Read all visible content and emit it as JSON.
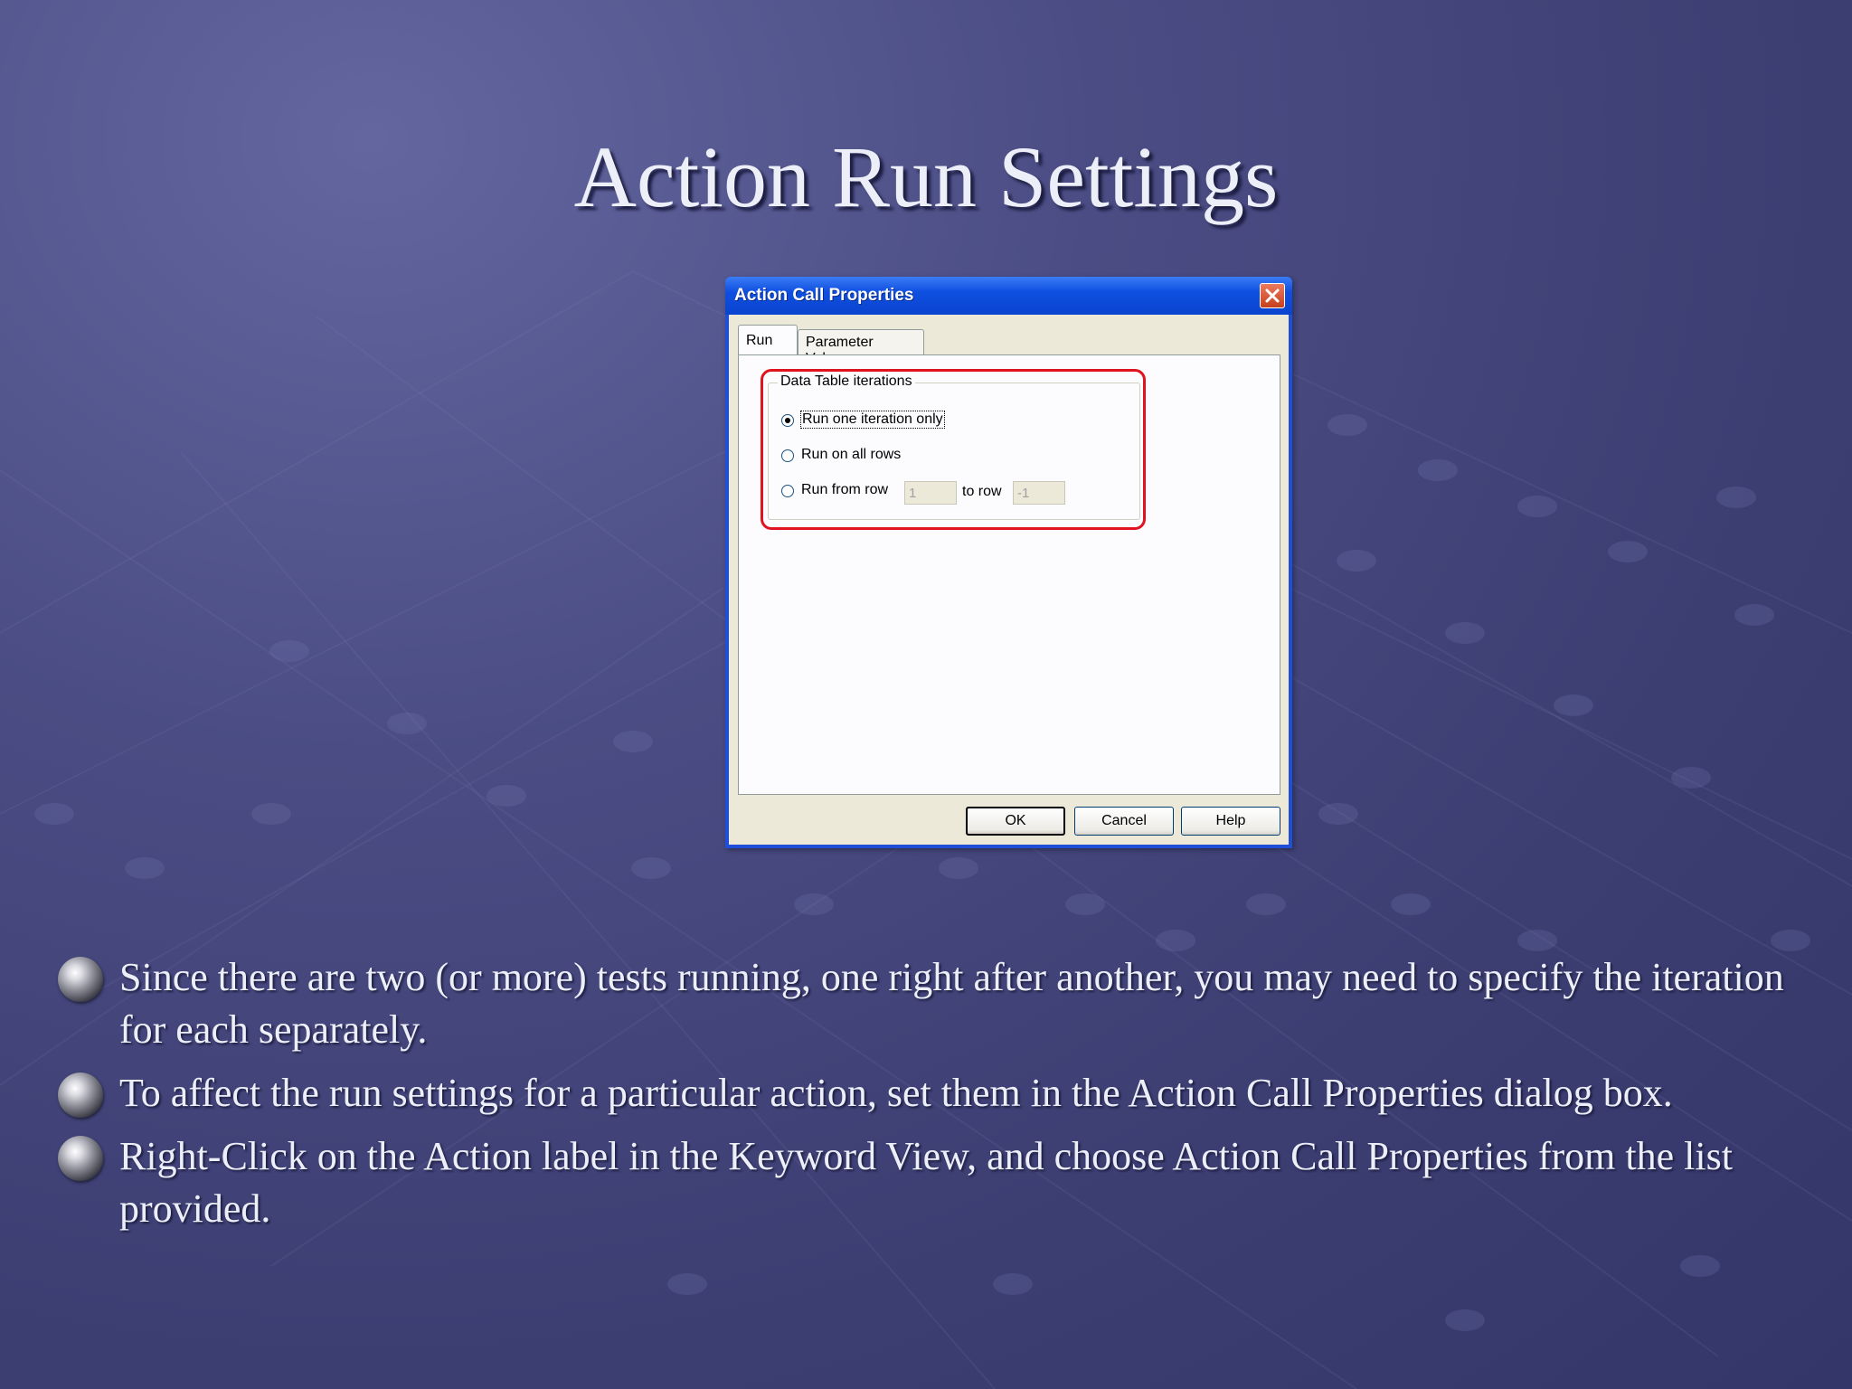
{
  "slide": {
    "title": "Action Run Settings",
    "bullets": [
      "Since there are two (or more) tests running, one right after another,  you may need to specify the iteration for each separately.",
      "To affect the run settings for a particular action, set them in the Action Call Properties dialog box.",
      "Right-Click on the Action label in the Keyword View, and choose Action Call Properties from the list provided."
    ]
  },
  "dialog": {
    "title": "Action Call Properties",
    "close_icon": "close-icon",
    "tabs": [
      {
        "label": "Run",
        "active": true
      },
      {
        "label": "Parameter Values",
        "active": false
      }
    ],
    "group": {
      "legend": "Data Table iterations",
      "options": [
        {
          "label": "Run one iteration only",
          "selected": true
        },
        {
          "label": "Run on all rows",
          "selected": false
        },
        {
          "label": "Run from row",
          "selected": false
        }
      ],
      "from_row_value": "1",
      "to_row_label": "to row",
      "to_row_value": "-1"
    },
    "buttons": {
      "ok": "OK",
      "cancel": "Cancel",
      "help": "Help"
    }
  },
  "colors": {
    "highlight": "#e0141e",
    "titlebar": "#0a44cf",
    "background": "#4a4c83"
  }
}
